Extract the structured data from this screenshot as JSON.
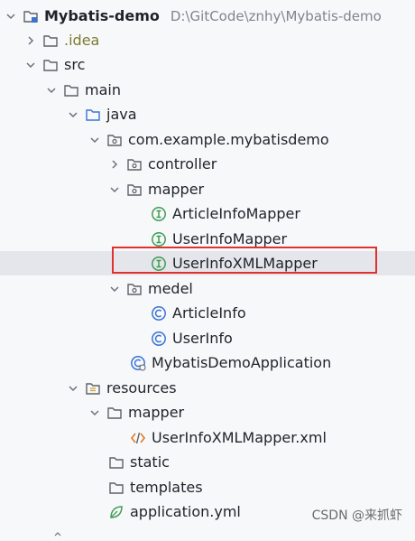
{
  "project": {
    "name": "Mybatis-demo",
    "path": "D:\\GitCode\\znhy\\Mybatis-demo"
  },
  "tree": {
    "idea": ".idea",
    "src": "src",
    "main": "main",
    "java": "java",
    "package": "com.example.mybatisdemo",
    "controller": "controller",
    "mapper_pkg": "mapper",
    "article_mapper": "ArticleInfoMapper",
    "user_mapper": "UserInfoMapper",
    "user_xml_mapper": "UserInfoXMLMapper",
    "medel_pkg": "medel",
    "article_info": "ArticleInfo",
    "user_info": "UserInfo",
    "application_class": "MybatisDemoApplication",
    "resources": "resources",
    "res_mapper": "mapper",
    "xml_file": "UserInfoXMLMapper.xml",
    "static": "static",
    "templates": "templates",
    "application_yml": "application.yml"
  },
  "watermark": "CSDN @来抓虾",
  "colors": {
    "folder": "#5e6168",
    "interface": "#3e9c52",
    "class": "#3b73d4",
    "highlight": "#e03131",
    "xml": "#e07b28",
    "idea_text": "#7d7a2c"
  }
}
